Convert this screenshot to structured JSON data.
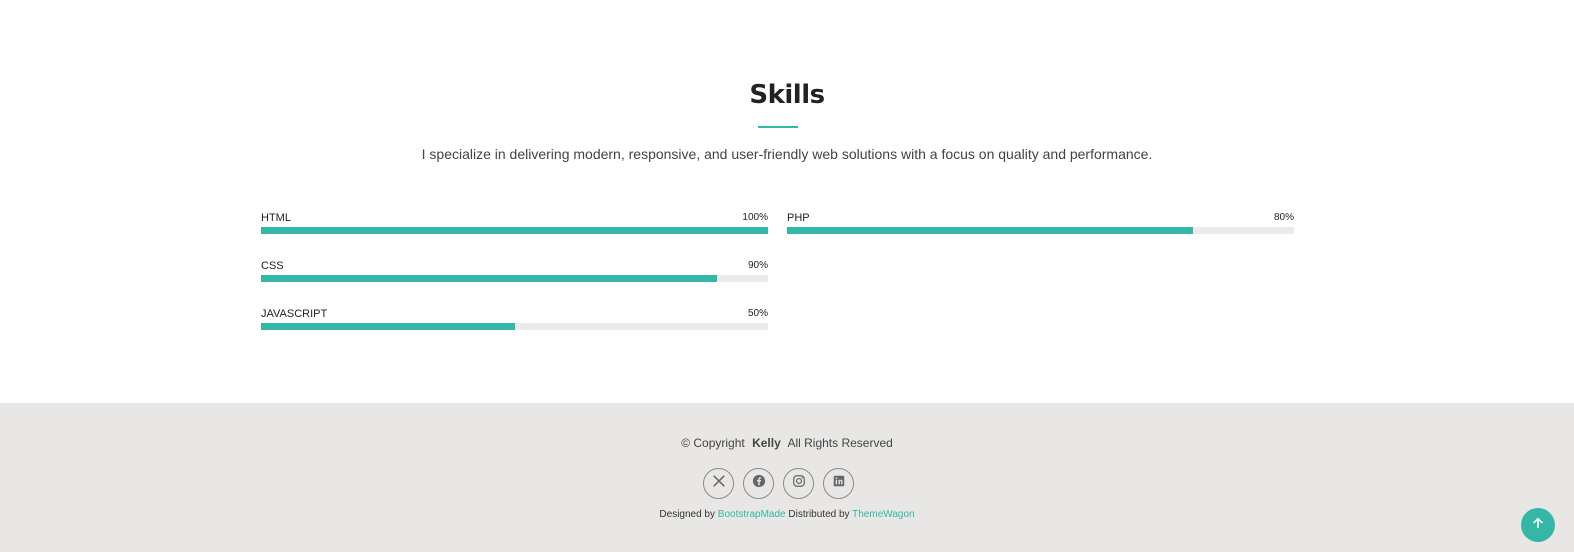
{
  "skills": {
    "title": "Skills",
    "description": "I specialize in delivering modern, responsive, and user-friendly web solutions with a focus on quality and performance.",
    "accent_color": "#34b7a7",
    "items": [
      {
        "name": "HTML",
        "value_label": "100%",
        "value": 100
      },
      {
        "name": "CSS",
        "value_label": "90%",
        "value": 90
      },
      {
        "name": "JAVASCRIPT",
        "value_label": "50%",
        "value": 50
      },
      {
        "name": "PHP",
        "value_label": "80%",
        "value": 80
      }
    ]
  },
  "footer": {
    "copyright_prefix": "© Copyright",
    "brand": "Kelly",
    "copyright_suffix": "All Rights Reserved",
    "socials": [
      "x-icon",
      "facebook-icon",
      "instagram-icon",
      "linkedin-icon"
    ],
    "designed_by_label": "Designed by",
    "designed_by_link": "BootstrapMade",
    "distributed_by_label": "Distributed by",
    "distributed_by_link": "ThemeWagon"
  },
  "back_to_top_icon": "arrow-up-icon"
}
